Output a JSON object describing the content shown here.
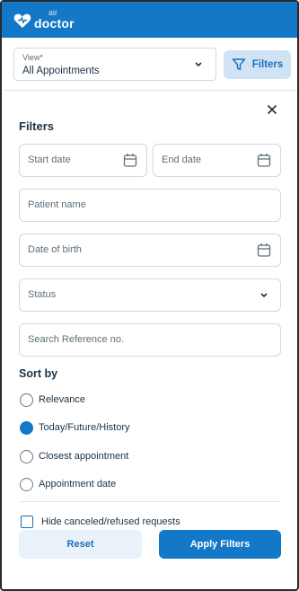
{
  "header": {
    "logo_air": "air",
    "logo_doctor": "doctor"
  },
  "view": {
    "label": "View*",
    "value": "All Appointments"
  },
  "filters_button": {
    "label": "Filters"
  },
  "panel": {
    "title": "Filters",
    "start_date": "Start date",
    "end_date": "End date",
    "patient_name": "Patient name",
    "date_of_birth": "Date of birth",
    "status": "Status",
    "search_reference": "Search Reference no."
  },
  "sort": {
    "title": "Sort by",
    "options": [
      {
        "label": "Relevance",
        "checked": false
      },
      {
        "label": "Today/Future/History",
        "checked": true
      },
      {
        "label": "Closest appointment",
        "checked": false
      },
      {
        "label": "Appointment date",
        "checked": false
      }
    ]
  },
  "hide_canceled": {
    "label": "Hide canceled/refused requests",
    "checked": false
  },
  "actions": {
    "reset": "Reset",
    "apply": "Apply Filters"
  },
  "colors": {
    "brand": "#1478c8",
    "button_light": "#cfe3f4",
    "text": "#1c3244"
  },
  "icons": {
    "logo": "heart-logo-icon",
    "chevron": "chevron-down-icon",
    "filter": "filter-funnel-icon",
    "close": "close-icon",
    "calendar": "calendar-icon"
  }
}
